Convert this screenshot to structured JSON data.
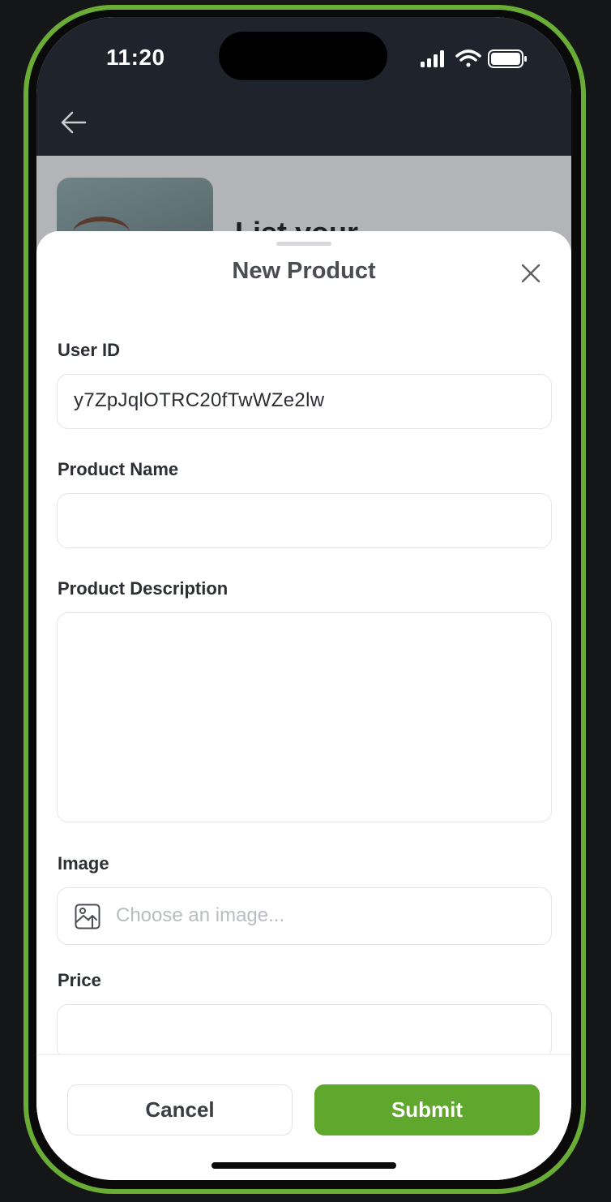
{
  "status_bar": {
    "time": "11:20"
  },
  "behind": {
    "title": "List your"
  },
  "sheet": {
    "title": "New Product",
    "fields": {
      "user_id": {
        "label": "User ID",
        "value": "y7ZpJqlOTRC20fTwWZe2lw"
      },
      "product_name": {
        "label": "Product Name",
        "value": ""
      },
      "product_description": {
        "label": "Product Description",
        "value": ""
      },
      "image": {
        "label": "Image",
        "placeholder": "Choose an image..."
      },
      "price": {
        "label": "Price",
        "value": ""
      }
    }
  },
  "actions": {
    "cancel": "Cancel",
    "submit": "Submit"
  },
  "colors": {
    "accent": "#5fa72d",
    "frame": "#6aad36",
    "topbar": "#1e232c"
  },
  "icons": [
    "back-arrow-icon",
    "close-icon",
    "image-upload-icon",
    "signal-icon",
    "wifi-icon",
    "battery-icon"
  ]
}
